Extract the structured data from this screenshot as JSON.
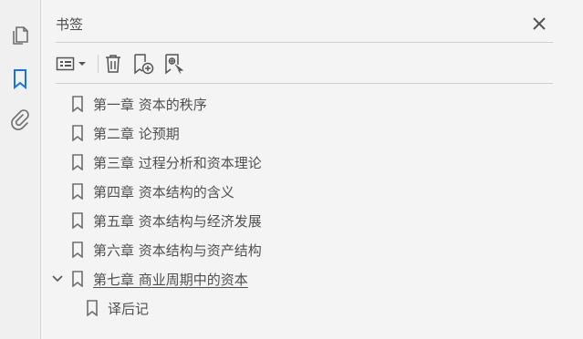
{
  "rail": {
    "items": [
      {
        "name": "pages-icon"
      },
      {
        "name": "bookmarks-icon"
      },
      {
        "name": "attachments-icon"
      }
    ]
  },
  "panel": {
    "title": "书签"
  },
  "bookmarks": [
    {
      "label": "第一章  资本的秩序"
    },
    {
      "label": "第二章  论预期"
    },
    {
      "label": "第三章  过程分析和资本理论"
    },
    {
      "label": "第四章  资本结构的含义"
    },
    {
      "label": "第五章  资本结构与经济发展"
    },
    {
      "label": "第六章  资本结构与资产结构"
    },
    {
      "label": "第七章  商业周期中的资本",
      "expanded": true
    },
    {
      "label": "译后记",
      "child": true
    }
  ],
  "colors": {
    "accent": "#1473e6",
    "icon": "#6e6e6e"
  }
}
